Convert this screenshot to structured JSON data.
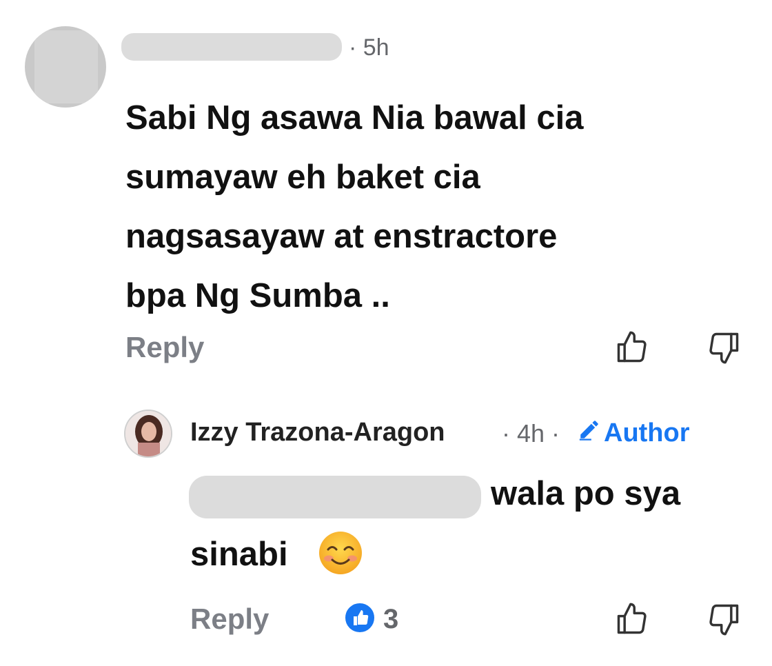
{
  "comment": {
    "time": "· 5h",
    "text_lines": [
      "Sabi Ng asawa Nia bawal cia",
      "sumayaw eh baket cia",
      "nagsasayaw at enstractore",
      "bpa Ng Sumba .."
    ],
    "reply_label": "Reply"
  },
  "reply": {
    "author_name": "Izzy Trazona-Aragon",
    "time": "· 4h ·",
    "badge_label": "Author",
    "text_line1": "wala po sya",
    "text_line2": "sinabi",
    "reply_label": "Reply",
    "reaction_count": "3"
  },
  "icons": {
    "like": "thumbs-up-icon",
    "dislike": "thumbs-down-icon",
    "author_badge": "pencil-icon",
    "reaction": "like-reaction-icon",
    "emoji": "smiling-face-emoji"
  },
  "colors": {
    "accent": "#1877f2",
    "meta": "#65676b",
    "reply": "#7c7f86"
  }
}
